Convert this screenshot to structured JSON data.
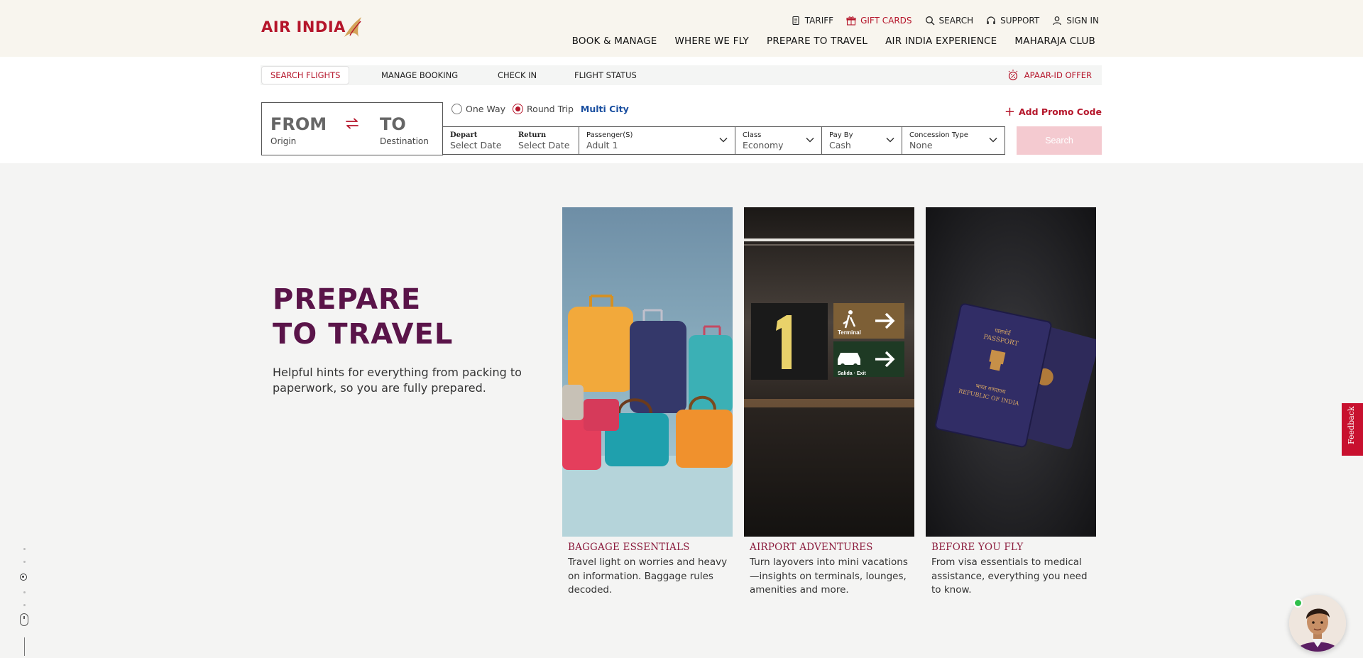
{
  "brand": {
    "logo_text": "AIR INDIA",
    "primary_color": "#b5162b",
    "hero_color": "#5a1449"
  },
  "utility_nav": [
    {
      "label": "TARIFF",
      "icon": "document-icon"
    },
    {
      "label": "GIFT CARDS",
      "icon": "gift-icon"
    },
    {
      "label": "SEARCH",
      "icon": "search-icon"
    },
    {
      "label": "SUPPORT",
      "icon": "headset-icon"
    },
    {
      "label": "SIGN IN",
      "icon": "user-icon"
    }
  ],
  "main_nav": [
    "BOOK & MANAGE",
    "WHERE WE FLY",
    "PREPARE TO TRAVEL",
    "AIR INDIA EXPERIENCE",
    "MAHARAJA CLUB"
  ],
  "booking_tabs": [
    "SEARCH FLIGHTS",
    "MANAGE BOOKING",
    "CHECK IN",
    "FLIGHT STATUS"
  ],
  "offer": {
    "label": "APAAR-ID OFFER",
    "icon": "offer-icon"
  },
  "search_form": {
    "from_label": "FROM",
    "from_sub": "Origin",
    "to_label": "TO",
    "to_sub": "Destination",
    "trip_types": [
      "One Way",
      "Round Trip",
      "Multi City"
    ],
    "selected_trip": "Round Trip",
    "depart_label": "Depart",
    "depart_value": "Select Date",
    "return_label": "Return",
    "return_value": "Select Date",
    "passengers_label": "Passenger(S)",
    "passengers_value": "Adult 1",
    "class_label": "Class",
    "class_value": "Economy",
    "pay_label": "Pay By",
    "pay_value": "Cash",
    "concession_label": "Concession Type",
    "concession_value": "None",
    "promo_label": "Add Promo Code",
    "search_label": "Search"
  },
  "hero": {
    "title_line1": "PREPARE",
    "title_line2": "TO TRAVEL",
    "subtitle": "Helpful hints for everything from packing to paperwork, so you are fully prepared."
  },
  "cards": [
    {
      "title": "BAGGAGE ESSENTIALS",
      "desc": "Travel light on worries and heavy on information. Baggage rules decoded."
    },
    {
      "title": "AIRPORT ADVENTURES",
      "desc": "Turn layovers into mini vacations—insights on terminals, lounges, amenities and more."
    },
    {
      "title": "BEFORE YOU FLY",
      "desc": "From visa essentials to medical assistance, everything you need to know."
    }
  ],
  "airport_sign": {
    "number": "1",
    "terminal": "Terminal",
    "exit": "Salida · Exit"
  },
  "passport_text": {
    "top": "पासपोर्ट",
    "word": "PASSPORT",
    "country_hi": "भारत गणराज्य",
    "country": "REPUBLIC OF INDIA"
  },
  "feedback_label": "Feedback"
}
